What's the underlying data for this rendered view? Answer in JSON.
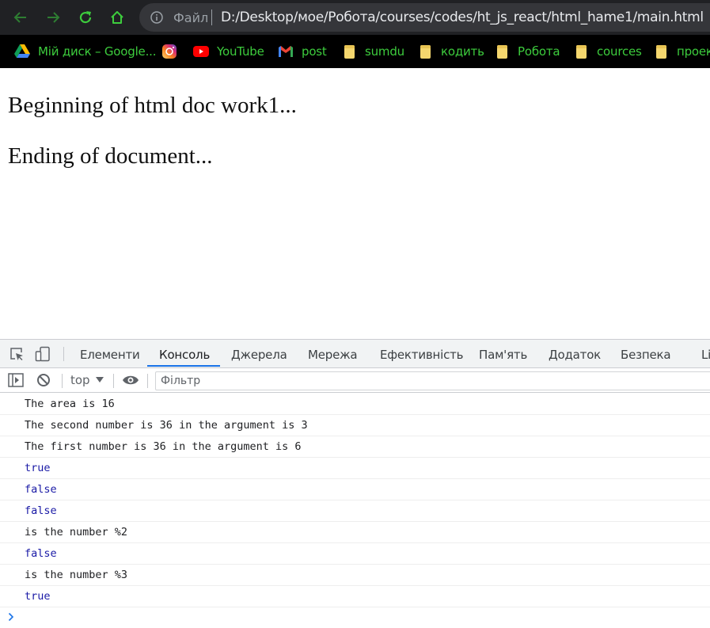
{
  "toolbar": {
    "scheme_label": "Файл",
    "url": "D:/Desktop/мое/Робота/courses/codes/ht_js_react/html_hame1/main.html",
    "nav_icons": [
      "back-arrow-icon",
      "forward-arrow-icon",
      "reload-icon",
      "home-icon"
    ]
  },
  "bookmarks": [
    {
      "label": "Мій диск – Google...",
      "icon": "google-drive-icon"
    },
    {
      "label": "",
      "icon": "instagram-icon"
    },
    {
      "label": "YouTube",
      "icon": "youtube-icon"
    },
    {
      "label": "post",
      "icon": "gmail-icon"
    },
    {
      "label": "sumdu",
      "icon": "folder-icon"
    },
    {
      "label": "кодить",
      "icon": "folder-icon"
    },
    {
      "label": "Робота",
      "icon": "folder-icon"
    },
    {
      "label": "cources",
      "icon": "folder-icon"
    },
    {
      "label": "проек",
      "icon": "folder-icon"
    }
  ],
  "page": {
    "line1": "Beginning of html doc work1...",
    "line2": "Ending of document..."
  },
  "devtools": {
    "tabs": [
      "Елементи",
      "Консоль",
      "Джерела",
      "Мережа",
      "Ефективність",
      "Пам'ять",
      "Додаток",
      "Безпека",
      "Li"
    ],
    "active_tab": "Консоль",
    "context": "top",
    "filter_placeholder": "Фільтр",
    "console_lines": [
      {
        "text": "The area is 16",
        "type": "string"
      },
      {
        "text": "The second number is 36 in the argument is 3",
        "type": "string"
      },
      {
        "text": "The first number is 36 in the argument is 6",
        "type": "string"
      },
      {
        "text": "true",
        "type": "boolean"
      },
      {
        "text": "false",
        "type": "boolean"
      },
      {
        "text": "false",
        "type": "boolean"
      },
      {
        "text": "is the number %2",
        "type": "string"
      },
      {
        "text": "false",
        "type": "boolean"
      },
      {
        "text": "is the number %3",
        "type": "string"
      },
      {
        "text": "true",
        "type": "boolean"
      }
    ]
  },
  "colors": {
    "bookmark_text": "#3dcc3d",
    "nav_icon": "#3dcc3d",
    "tab_active_underline": "#1a73e8",
    "console_boolean": "#1a1aa6"
  }
}
